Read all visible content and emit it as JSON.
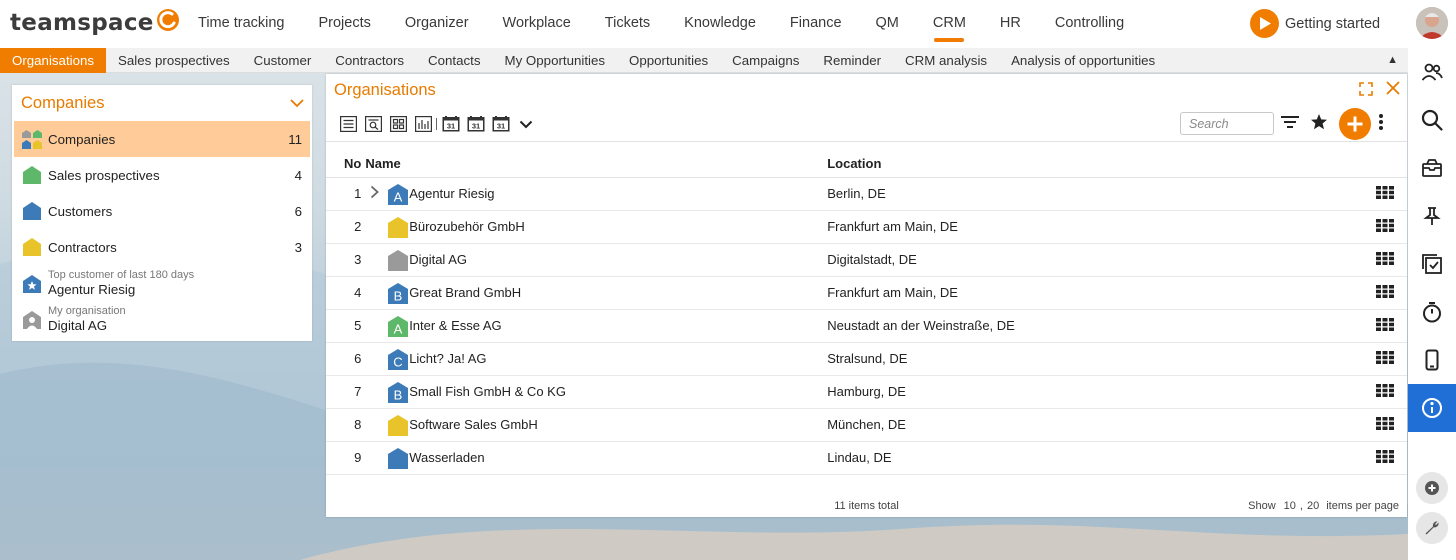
{
  "app": {
    "logo_text": "teamspace"
  },
  "main_nav": [
    {
      "label": "Time tracking",
      "active": false
    },
    {
      "label": "Projects",
      "active": false
    },
    {
      "label": "Organizer",
      "active": false
    },
    {
      "label": "Workplace",
      "active": false
    },
    {
      "label": "Tickets",
      "active": false
    },
    {
      "label": "Knowledge",
      "active": false
    },
    {
      "label": "Finance",
      "active": false
    },
    {
      "label": "QM",
      "active": false
    },
    {
      "label": "CRM",
      "active": true
    },
    {
      "label": "HR",
      "active": false
    },
    {
      "label": "Controlling",
      "active": false
    }
  ],
  "getting_started": "Getting started",
  "sub_nav": [
    {
      "label": "Organisations",
      "active": true
    },
    {
      "label": "Sales prospectives"
    },
    {
      "label": "Customer"
    },
    {
      "label": "Contractors"
    },
    {
      "label": "Contacts"
    },
    {
      "label": "My Opportunities"
    },
    {
      "label": "Opportunities"
    },
    {
      "label": "Campaigns"
    },
    {
      "label": "Reminder"
    },
    {
      "label": "CRM analysis"
    },
    {
      "label": "Analysis of opportunities"
    }
  ],
  "left_panel": {
    "title": "Companies",
    "items": [
      {
        "label": "Companies",
        "count": "11",
        "active": true,
        "icon": "companies-multi-icon"
      },
      {
        "label": "Sales prospectives",
        "count": "4",
        "icon": "green-house-icon"
      },
      {
        "label": "Customers",
        "count": "6",
        "icon": "blue-house-icon"
      },
      {
        "label": "Contractors",
        "count": "3",
        "icon": "yellow-house-icon"
      }
    ],
    "top_customer": {
      "caption": "Top customer of last 180 days",
      "name": "Agentur Riesig"
    },
    "my_org": {
      "caption": "My organisation",
      "name": "Digital AG"
    }
  },
  "main_panel": {
    "title": "Organisations",
    "search_placeholder": "Search",
    "columns": {
      "no": "No",
      "name": "Name",
      "location": "Location"
    },
    "rows": [
      {
        "no": "1",
        "name": "Agentur Riesig",
        "location": "Berlin, DE",
        "badge": "A",
        "color": "#3d7ab8",
        "expandable": true
      },
      {
        "no": "2",
        "name": "Bürozubehör GmbH",
        "location": "Frankfurt am Main, DE",
        "badge": "",
        "color": "#e8c42a"
      },
      {
        "no": "3",
        "name": "Digital AG",
        "location": "Digitalstadt, DE",
        "badge": "",
        "color": "#9a9a9a"
      },
      {
        "no": "4",
        "name": "Great Brand GmbH",
        "location": "Frankfurt am Main, DE",
        "badge": "B",
        "color": "#3d7ab8"
      },
      {
        "no": "5",
        "name": "Inter & Esse AG",
        "location": "Neustadt an der Weinstraße, DE",
        "badge": "A",
        "color": "#5db86a"
      },
      {
        "no": "6",
        "name": "Licht? Ja! AG",
        "location": "Stralsund, DE",
        "badge": "C",
        "color": "#3d7ab8"
      },
      {
        "no": "7",
        "name": "Small Fish GmbH & Co KG",
        "location": "Hamburg, DE",
        "badge": "B",
        "color": "#3d7ab8"
      },
      {
        "no": "8",
        "name": "Software Sales GmbH",
        "location": "München, DE",
        "badge": "",
        "color": "#e8c42a"
      },
      {
        "no": "9",
        "name": "Wasserladen",
        "location": "Lindau, DE",
        "badge": "",
        "color": "#3d7ab8"
      }
    ],
    "footer_total": "11 items total",
    "footer_show": "Show",
    "page_sizes": [
      "10",
      "20"
    ],
    "footer_per_page": "items per page"
  },
  "colors": {
    "accent": "#f07d00",
    "active_blue": "#1f6fd6",
    "selected_row": "#ffcb98"
  }
}
